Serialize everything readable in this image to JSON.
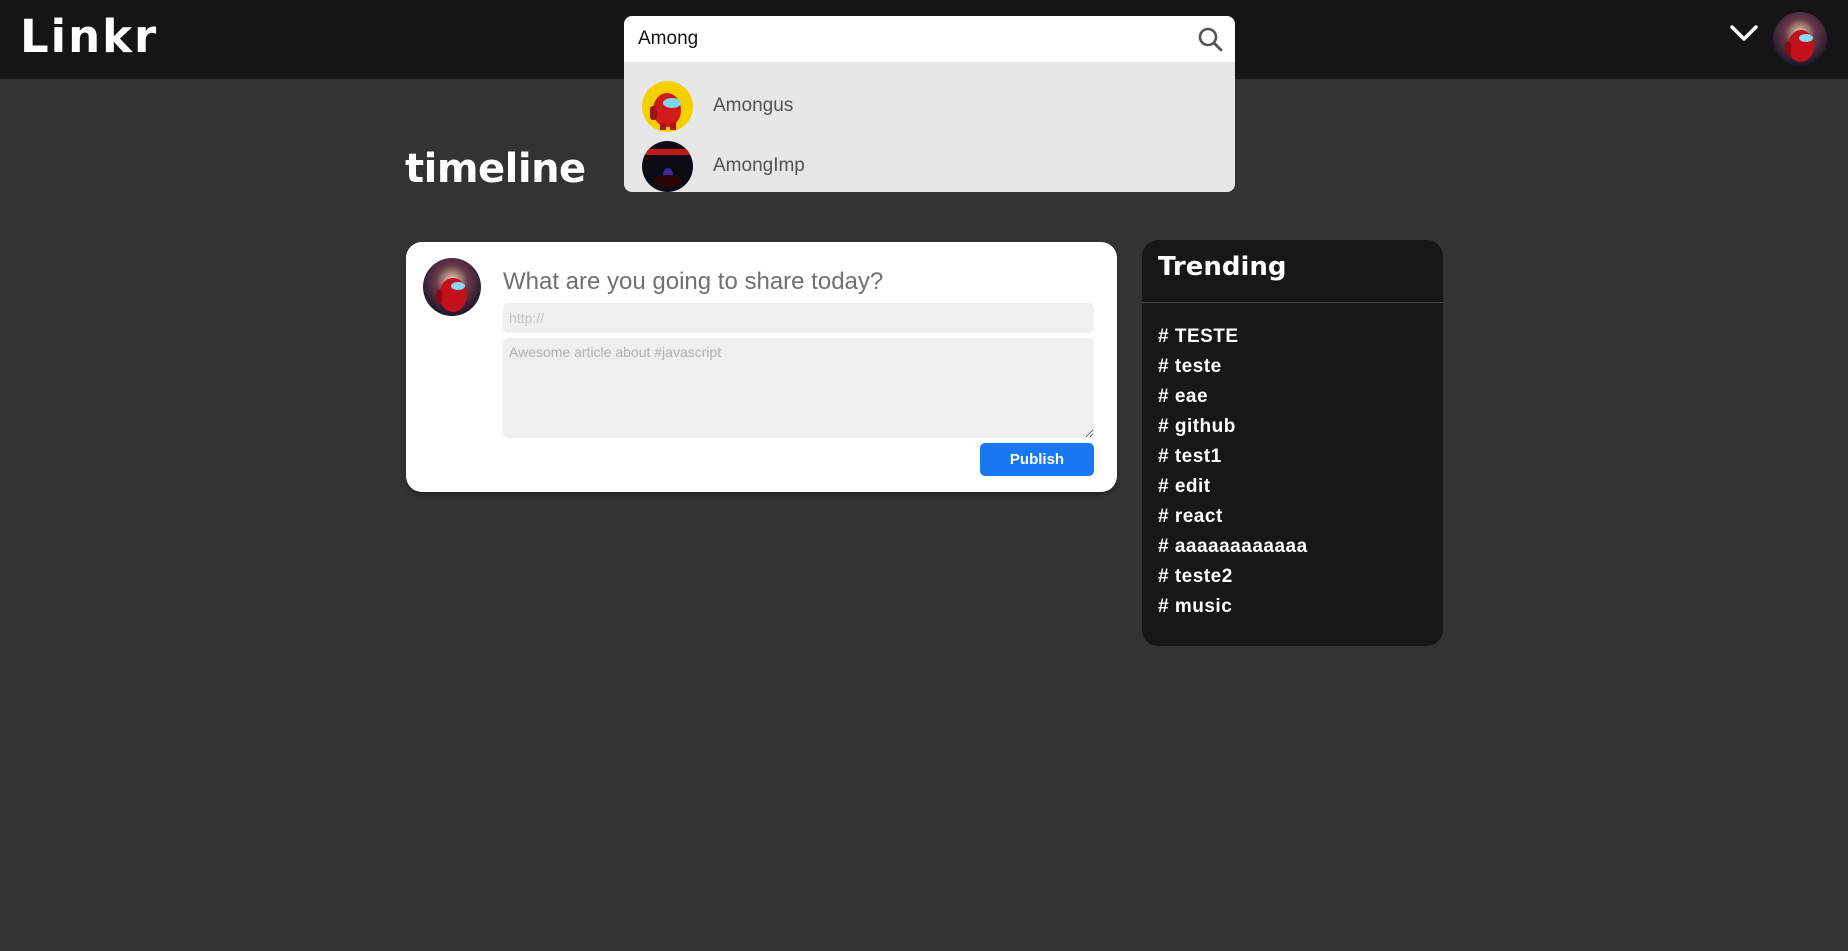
{
  "header": {
    "logo": "Linkr",
    "search": {
      "value": "Among",
      "results": [
        {
          "name": "Amongus"
        },
        {
          "name": "AmongImp"
        }
      ]
    }
  },
  "page": {
    "title": "timeline"
  },
  "composer": {
    "prompt": "What are you going to share today?",
    "url_placeholder": "http://",
    "description_placeholder": "Awesome article about #javascript",
    "publish_label": "Publish"
  },
  "trending": {
    "title": "Trending",
    "tags": [
      "# TESTE",
      "# teste",
      "# eae",
      "# github",
      "# test1",
      "# edit",
      "# react",
      "# aaaaaaaaaaaa",
      "# teste2",
      "# music"
    ]
  },
  "colors": {
    "background": "#333333",
    "header": "#151515",
    "accent": "#1877f2"
  }
}
